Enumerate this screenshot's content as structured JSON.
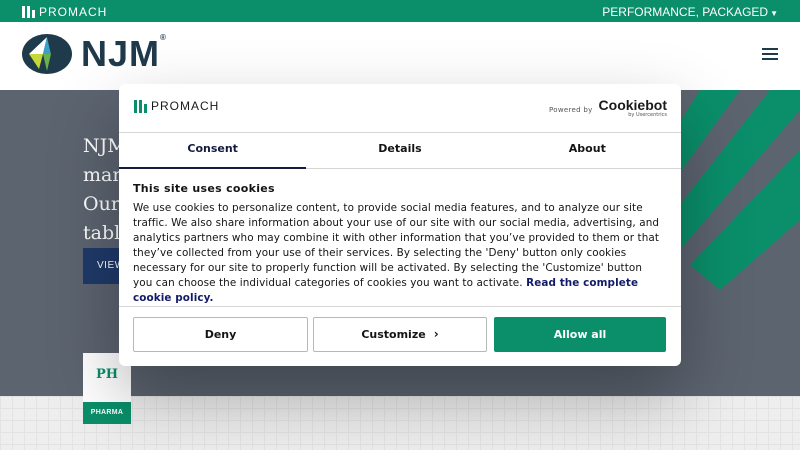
{
  "topbar": {
    "brand": "PROMACH",
    "tagline": "PERFORMANCE, PACKAGED",
    "tagline_icon": "caret-down-icon"
  },
  "header": {
    "logo_text": "NJM",
    "registered": "®",
    "menu_icon": "hamburger-icon"
  },
  "hero": {
    "lines": [
      "NJM",
      "man",
      "Our",
      "tabl"
    ],
    "button_label": "VIEW",
    "card_text": "PH",
    "card_label": "PHARMA"
  },
  "cookie_dialog": {
    "brand": "PROMACH",
    "powered_by": "Powered by",
    "provider": "Cookiebot",
    "provider_sub": "by Usercentrics",
    "tabs": [
      {
        "label": "Consent",
        "active": true
      },
      {
        "label": "Details",
        "active": false
      },
      {
        "label": "About",
        "active": false
      }
    ],
    "heading": "This site uses cookies",
    "body_text": "We use cookies to personalize content, to provide social media features, and to analyze our site traffic. We also share information about your use of our site with our social media, advertising, and analytics partners who may combine it with other information that you’ve provided to them or that they’ve collected from your use of their services. By selecting the 'Deny' button only cookies necessary for our site to properly function will be activated. By selecting the 'Customize' button you can choose the individual categories of cookies you want to activate.",
    "policy_link": "Read the complete cookie policy.",
    "buttons": {
      "deny": "Deny",
      "customize": "Customize",
      "allow": "Allow all"
    }
  },
  "colors": {
    "brand_green": "#0a8f6a",
    "navy": "#141a40",
    "hero_gray": "#5c6470"
  }
}
